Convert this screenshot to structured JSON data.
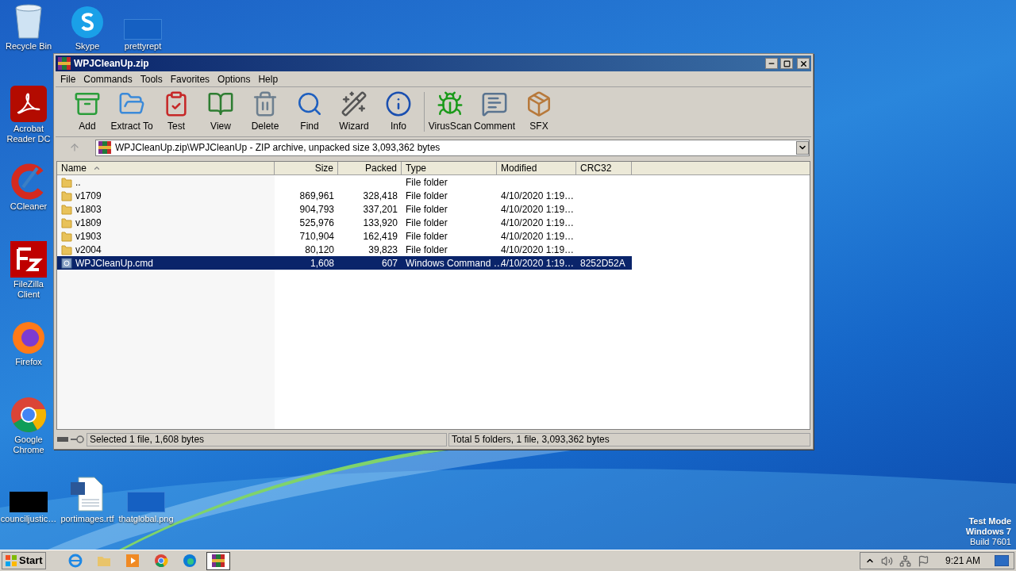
{
  "desktop_icons": [
    {
      "label": "Recycle Bin",
      "kind": "recycle"
    },
    {
      "label": "Skype",
      "kind": "skype"
    },
    {
      "label": "prettyrept",
      "kind": "blank"
    },
    {
      "label": "Acrobat Reader DC",
      "kind": "acrobat"
    },
    {
      "label": "CCleaner",
      "kind": "ccleaner"
    },
    {
      "label": "FileZilla Client",
      "kind": "filezilla"
    },
    {
      "label": "Firefox",
      "kind": "firefox"
    },
    {
      "label": "Google Chrome",
      "kind": "chrome"
    },
    {
      "label": "counciljustic…",
      "kind": "black"
    },
    {
      "label": "portimages.rtf",
      "kind": "word"
    },
    {
      "label": "thatglobal.png",
      "kind": "blank"
    }
  ],
  "window": {
    "title": "WPJCleanUp.zip",
    "menu": [
      "File",
      "Commands",
      "Tools",
      "Favorites",
      "Options",
      "Help"
    ],
    "toolbar": [
      {
        "label": "Add",
        "kind": "add"
      },
      {
        "label": "Extract To",
        "kind": "extract"
      },
      {
        "label": "Test",
        "kind": "test"
      },
      {
        "label": "View",
        "kind": "view"
      },
      {
        "label": "Delete",
        "kind": "delete"
      },
      {
        "label": "Find",
        "kind": "find"
      },
      {
        "label": "Wizard",
        "kind": "wizard"
      },
      {
        "label": "Info",
        "kind": "info"
      },
      {
        "label": "VirusScan",
        "kind": "virus"
      },
      {
        "label": "Comment",
        "kind": "comment"
      },
      {
        "label": "SFX",
        "kind": "sfx"
      }
    ],
    "address": "WPJCleanUp.zip\\WPJCleanUp - ZIP archive, unpacked size 3,093,362 bytes",
    "columns": [
      {
        "label": "Name",
        "sorted": true
      },
      {
        "label": "Size",
        "sorted": false
      },
      {
        "label": "Packed",
        "sorted": false
      },
      {
        "label": "Type",
        "sorted": false
      },
      {
        "label": "Modified",
        "sorted": false
      },
      {
        "label": "CRC32",
        "sorted": false
      }
    ],
    "rows": [
      {
        "kind": "folder",
        "name": "..",
        "size": "",
        "packed": "",
        "type": "File folder",
        "modified": "",
        "crc": "",
        "selected": false
      },
      {
        "kind": "folder",
        "name": "v1709",
        "size": "869,961",
        "packed": "328,418",
        "type": "File folder",
        "modified": "4/10/2020 1:19…",
        "crc": "",
        "selected": false
      },
      {
        "kind": "folder",
        "name": "v1803",
        "size": "904,793",
        "packed": "337,201",
        "type": "File folder",
        "modified": "4/10/2020 1:19…",
        "crc": "",
        "selected": false
      },
      {
        "kind": "folder",
        "name": "v1809",
        "size": "525,976",
        "packed": "133,920",
        "type": "File folder",
        "modified": "4/10/2020 1:19…",
        "crc": "",
        "selected": false
      },
      {
        "kind": "folder",
        "name": "v1903",
        "size": "710,904",
        "packed": "162,419",
        "type": "File folder",
        "modified": "4/10/2020 1:19…",
        "crc": "",
        "selected": false
      },
      {
        "kind": "folder",
        "name": "v2004",
        "size": "80,120",
        "packed": "39,823",
        "type": "File folder",
        "modified": "4/10/2020 1:19…",
        "crc": "",
        "selected": false
      },
      {
        "kind": "script",
        "name": "WPJCleanUp.cmd",
        "size": "1,608",
        "packed": "607",
        "type": "Windows Command …",
        "modified": "4/10/2020 1:19…",
        "crc": "8252D52A",
        "selected": true
      }
    ],
    "status_left": "Selected 1 file, 1,608 bytes",
    "status_right": "Total 5 folders, 1 file, 3,093,362 bytes"
  },
  "os_notice": [
    "Test Mode",
    "Windows 7",
    "Build 7601"
  ],
  "taskbar": {
    "start": "Start",
    "apps": [
      {
        "kind": "ie",
        "selected": false
      },
      {
        "kind": "explorer",
        "selected": false
      },
      {
        "kind": "media",
        "selected": false
      },
      {
        "kind": "chrome",
        "selected": false
      },
      {
        "kind": "edge",
        "selected": false
      },
      {
        "kind": "winrar",
        "selected": true
      }
    ],
    "clock": "9:21 AM"
  }
}
